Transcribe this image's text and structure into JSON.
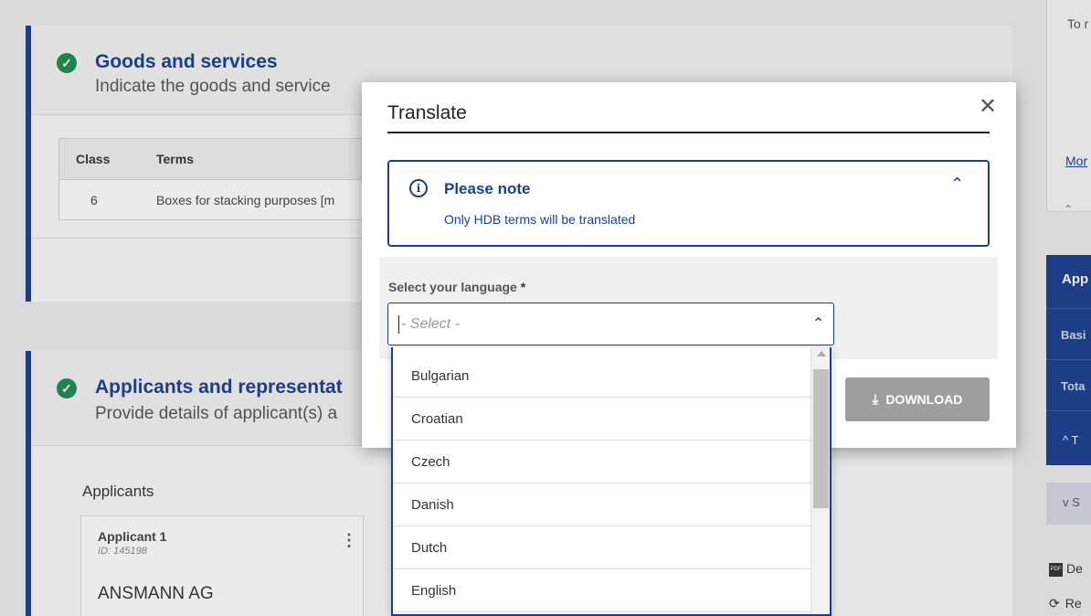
{
  "goods": {
    "title": "Goods and services",
    "subtitle": "Indicate the goods and service",
    "table": {
      "col_class": "Class",
      "col_terms": "Terms",
      "rows": [
        {
          "class": "6",
          "terms": "Boxes for stacking purposes [m"
        }
      ]
    }
  },
  "applicants_section": {
    "title": "Applicants and representat",
    "subtitle": "Provide details of applicant(s) a",
    "list_label": "Applicants",
    "applicant": {
      "title": "Applicant 1",
      "id": "ID: 145198",
      "name": "ANSMANN AG"
    }
  },
  "right_panel": {
    "top_text": "To r",
    "more_link": "Mor",
    "collapse_label": "^",
    "blue_title": "App",
    "blue_row1": "Basi",
    "blue_row2": "Tota",
    "blue_toggle": "^ T",
    "grey_toggle": "v S",
    "link1": "De",
    "link2": "Re"
  },
  "modal": {
    "title": "Translate",
    "note": {
      "title": "Please note",
      "text": "Only HDB terms will be translated"
    },
    "language_label": "Select your language",
    "required_mark": "*",
    "select_placeholder": "- Select -",
    "download_label": "DOWNLOAD",
    "languages": [
      "Bulgarian",
      "Croatian",
      "Czech",
      "Danish",
      "Dutch",
      "English"
    ]
  },
  "colors": {
    "brand_blue": "#1a3f8f",
    "success_green": "#1f8c4f",
    "disabled_button": "#9e9e9e"
  }
}
